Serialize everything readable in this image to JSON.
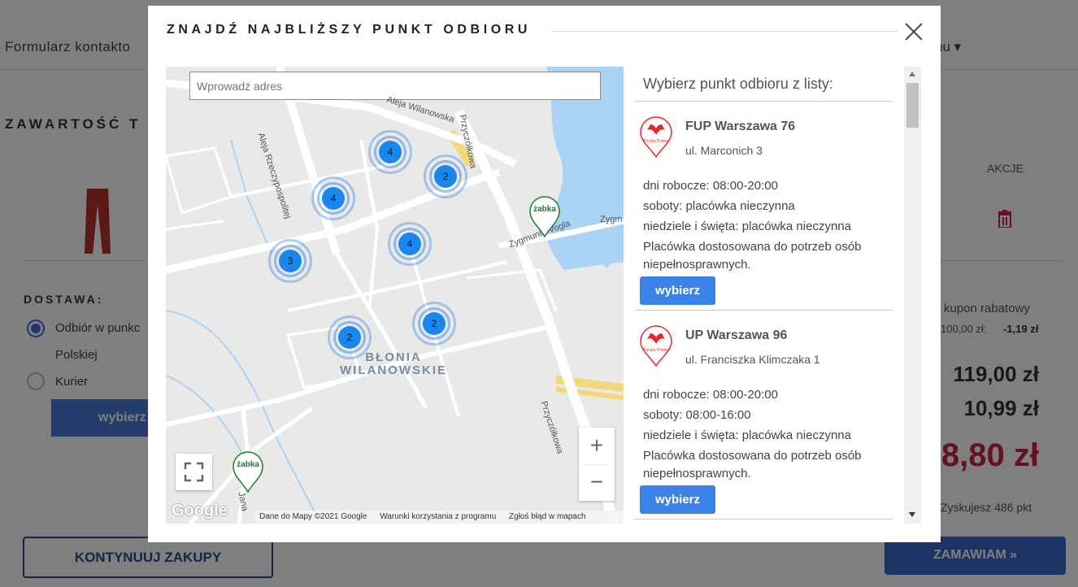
{
  "background": {
    "nav_left": "Formularz kontakto",
    "nav_right": "nu ▾",
    "section_title": "ZAWARTOŚĆ T",
    "akcje": "AKCJE",
    "dostawa_label": "DOSTAWA:",
    "option_pickup": "Odbiór w punkc",
    "option_pickup_line2": "Polskiej",
    "option_courier": "Kurier",
    "select_button": "wybierz",
    "coupon": "kupon rabatowy",
    "coupon_value_a": "100,00 zł:",
    "coupon_value_b": "-1,19 zł",
    "price_1": "119,00 zł",
    "price_2": "10,99 zł",
    "price_total": "8,80 zł",
    "points": "Zyskujesz 486 pkt",
    "continue_button": "KONTYNUUJ ZAKUPY",
    "order_button": "ZAMAWIAM »"
  },
  "modal": {
    "title": "ZNAJDŹ NAJBLIŻSZY PUNKT ODBIORU",
    "close_icon": "close-icon"
  },
  "map": {
    "search_placeholder": "Wprowadź adres",
    "clusters": [
      "4",
      "2",
      "4",
      "4",
      "3",
      "2",
      "2"
    ],
    "zabka_label": "żabka",
    "area_label_line1": "BŁONIA",
    "area_label_line2": "WILANOWSKIE",
    "street_labels": [
      "Aleja Wilanowska",
      "Aleja Rzeczypospolitej",
      "Przyczółkowa",
      "Zygmunta Vogla",
      "Zygm",
      "Przyczółkowa",
      "Jana"
    ],
    "zoom_in": "+",
    "zoom_out": "−",
    "google": "Google",
    "footer": [
      "Dane do Mapy ©2021 Google",
      "Warunki korzystania z programu",
      "Zgłoś błąd w mapach"
    ]
  },
  "list": {
    "heading": "Wybierz punkt odbioru z listy:",
    "logo_caption": "Poczta Polska",
    "items": [
      {
        "name": "FUP Warszawa 76",
        "address": "ul. Marconich 3",
        "weekdays": "dni robocze: 08:00-20:00",
        "saturdays": "soboty: placówka nieczynna",
        "holidays": "niedziele i święta: placówka nieczynna",
        "accessibility_1": "Placówka dostosowana do potrzeb osób",
        "accessibility_2": "niepełnosprawnych.",
        "button": "wybierz"
      },
      {
        "name": "UP Warszawa 96",
        "address": "ul. Franciszka Klimczaka 1",
        "weekdays": "dni robocze: 08:00-20:00",
        "saturdays": "soboty: 08:00-16:00",
        "holidays": "niedziele i święta: placówka nieczynna",
        "accessibility_1": "Placówka dostosowana do potrzeb osób",
        "accessibility_2": "niepełnosprawnych.",
        "button": "wybierz"
      }
    ]
  },
  "colors": {
    "accent_blue": "#3b82e8",
    "cluster_blue": "#1a86f0",
    "poczta_red": "#e8262c",
    "zabka_green": "#1f7a3a",
    "price_red": "#c8234a"
  }
}
